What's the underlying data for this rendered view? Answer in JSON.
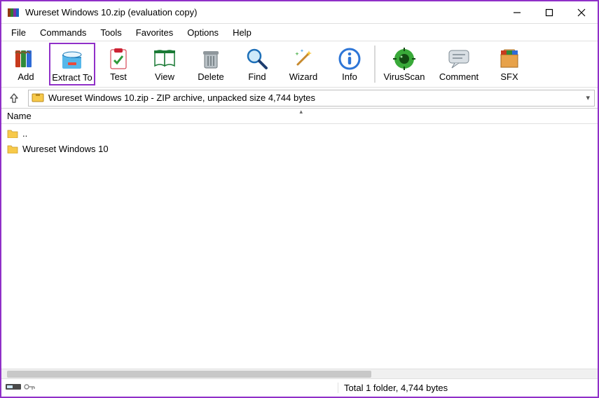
{
  "titlebar": {
    "title": "Wureset Windows 10.zip (evaluation copy)"
  },
  "menu": {
    "items": [
      "File",
      "Commands",
      "Tools",
      "Favorites",
      "Options",
      "Help"
    ]
  },
  "toolbar": {
    "add": "Add",
    "extract": "Extract To",
    "test": "Test",
    "view": "View",
    "delete": "Delete",
    "find": "Find",
    "wizard": "Wizard",
    "info": "Info",
    "virusscan": "VirusScan",
    "comment": "Comment",
    "sfx": "SFX"
  },
  "address": {
    "text": "Wureset Windows 10.zip - ZIP archive, unpacked size 4,744 bytes"
  },
  "columns": {
    "name": "Name"
  },
  "files": [
    {
      "name": ".."
    },
    {
      "name": "Wureset Windows 10"
    }
  ],
  "status": {
    "summary": "Total 1 folder, 4,744 bytes"
  }
}
